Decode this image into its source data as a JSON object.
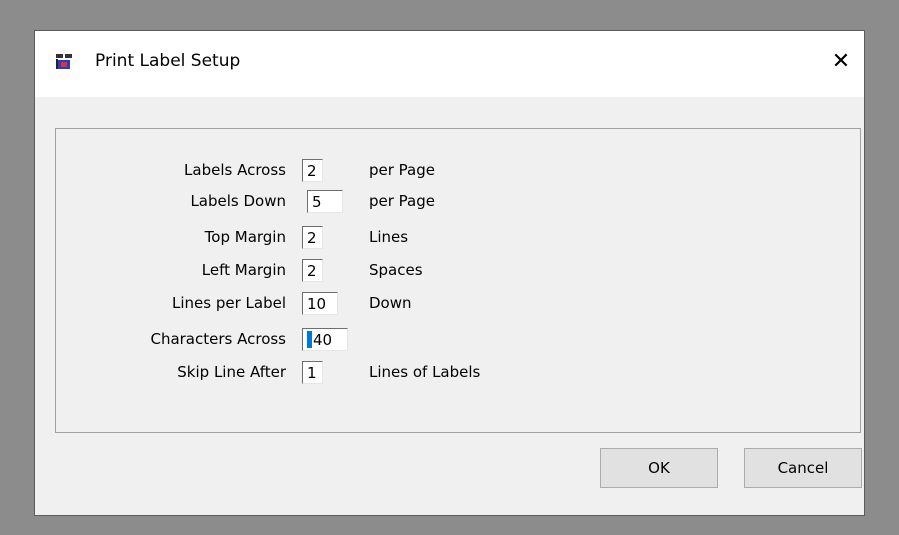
{
  "window": {
    "title": "Print Label Setup",
    "close_glyph": "✕"
  },
  "fields": [
    {
      "label": "Labels Across",
      "value": "2",
      "unit": "per Page"
    },
    {
      "label": "Labels Down",
      "value": "5",
      "unit": "per Page"
    },
    {
      "label": "Top Margin",
      "value": "2",
      "unit": "Lines"
    },
    {
      "label": "Left Margin",
      "value": "2",
      "unit": "Spaces"
    },
    {
      "label": "Lines per Label",
      "value": "10",
      "unit": "Down"
    },
    {
      "label": "Characters Across",
      "value": "40",
      "unit": ""
    },
    {
      "label": "Skip Line After",
      "value": "1",
      "unit": "Lines of Labels"
    }
  ],
  "buttons": {
    "ok": "OK",
    "cancel": "Cancel"
  },
  "icons": {
    "app": "app-icon",
    "close": "close-icon"
  }
}
